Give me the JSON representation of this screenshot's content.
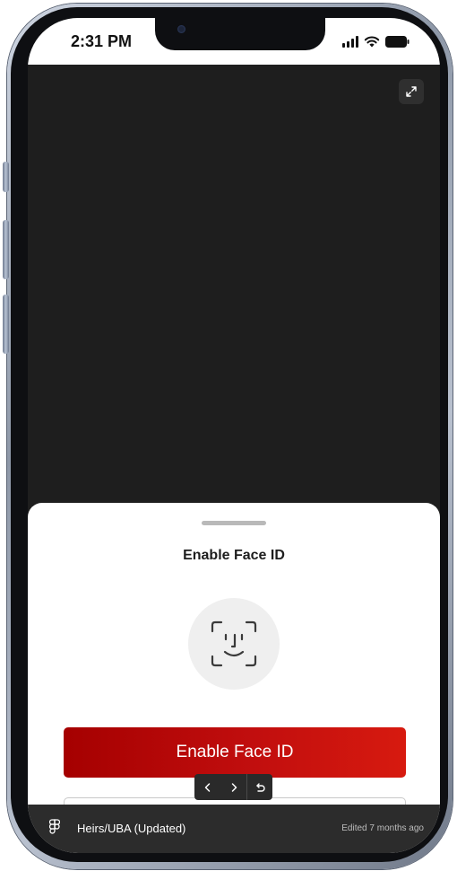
{
  "status_bar": {
    "time": "2:31 PM",
    "icons": [
      "signal-icon",
      "wifi-icon",
      "battery-icon"
    ]
  },
  "viewer": {
    "expand_icon": "expand-icon"
  },
  "sheet": {
    "title": "Enable Face ID",
    "face_icon": "face-id-icon",
    "primary_button_label": "Enable Face ID"
  },
  "prototype_nav": {
    "icons": [
      "chevron-left-icon",
      "chevron-right-icon",
      "restart-icon"
    ]
  },
  "footer": {
    "file_name": "Heirs/UBA (Updated)",
    "edited": "Edited 7 months ago"
  },
  "colors": {
    "primary": "#c10e0e",
    "screen_background": "#1e1e1e",
    "footer_background": "#2c2c2c"
  }
}
